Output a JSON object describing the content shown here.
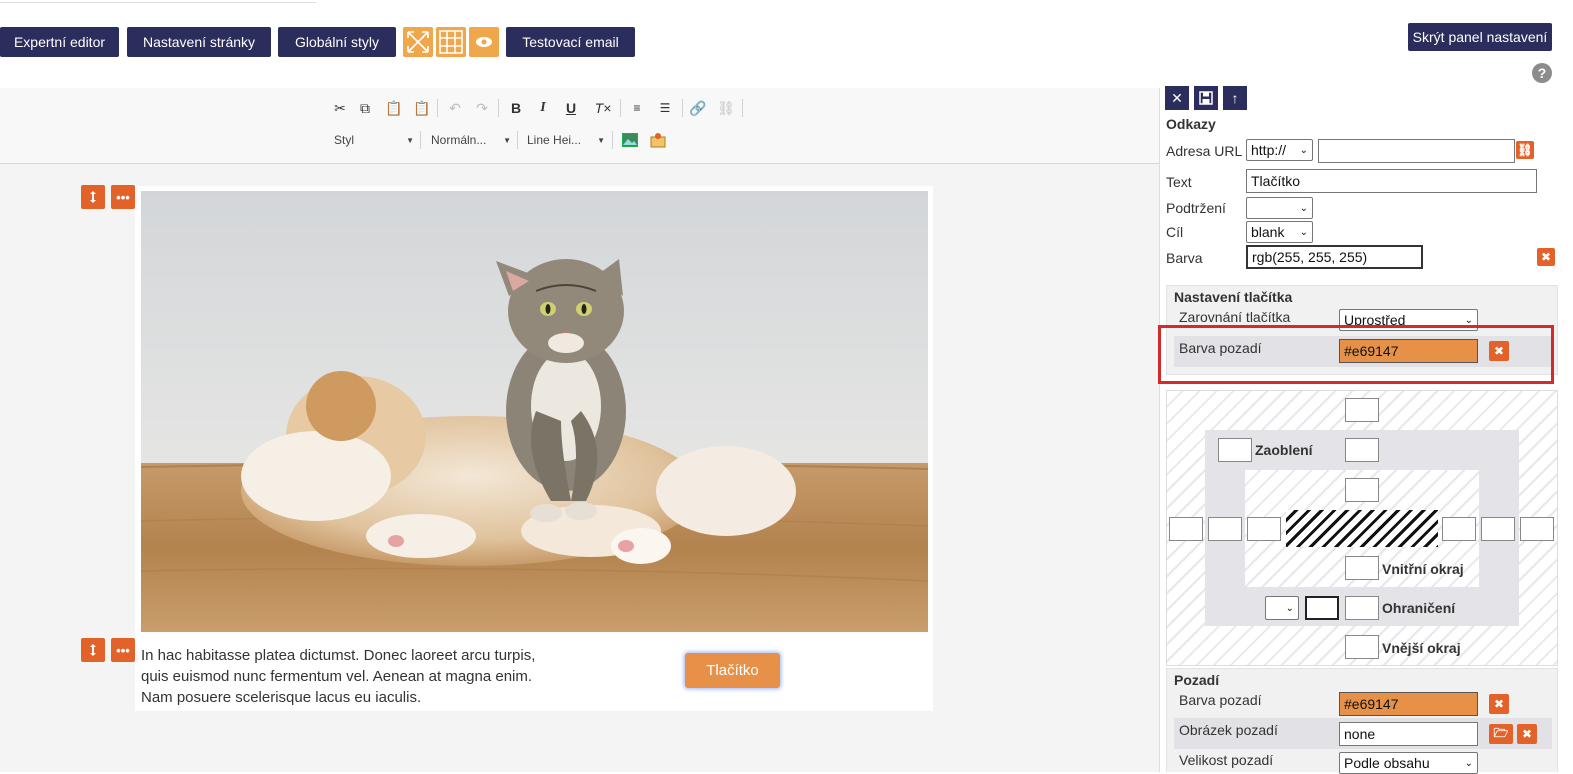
{
  "topbar": {
    "expert_editor": "Expertní editor",
    "page_settings": "Nastavení stránky",
    "global_styles": "Globální styly",
    "test_email": "Testovací email",
    "hide_panel": "Skrýt panel nastavení",
    "help": "?"
  },
  "toolbar": {
    "style": "Styl",
    "format": "Normáln...",
    "line_height": "Line Hei..."
  },
  "content": {
    "paragraph": "In hac habitasse platea dictumst. Donec laoreet arcu turpis, quis euismod nunc fermentum vel. Aenean at magna enim. Nam posuere scelerisque lacus eu iaculis.",
    "button_label": "Tlačítko"
  },
  "panel": {
    "links": {
      "heading": "Odkazy",
      "url_label": "Adresa URL",
      "protocol": "http://",
      "url_value": "",
      "text_label": "Text",
      "text_value": "Tlačítko",
      "underline_label": "Podtržení",
      "underline_value": "",
      "target_label": "Cíl",
      "target_value": "blank",
      "color_label": "Barva",
      "color_value": "rgb(255, 255, 255)"
    },
    "button_settings": {
      "heading": "Nastavení tlačítka",
      "align_label": "Zarovnání tlačítka",
      "align_value": "Uprostřed",
      "bg_label": "Barva pozadí",
      "bg_value": "#e69147"
    },
    "box_model": {
      "rounding": "Zaoblení",
      "padding": "Vnitřní okraj",
      "border": "Ohraničení",
      "margin": "Vnější okraj"
    },
    "background": {
      "heading": "Pozadí",
      "bg_color_label": "Barva pozadí",
      "bg_color_value": "#e69147",
      "bg_image_label": "Obrázek pozadí",
      "bg_image_value": "none",
      "bg_size_label": "Velikost pozadí",
      "bg_size_value": "Podle obsahu"
    }
  },
  "colors": {
    "navy": "#2b2d5c",
    "orange": "#e69147",
    "ctrl_orange": "#e2622a",
    "highlight_red": "#d52a2a"
  }
}
